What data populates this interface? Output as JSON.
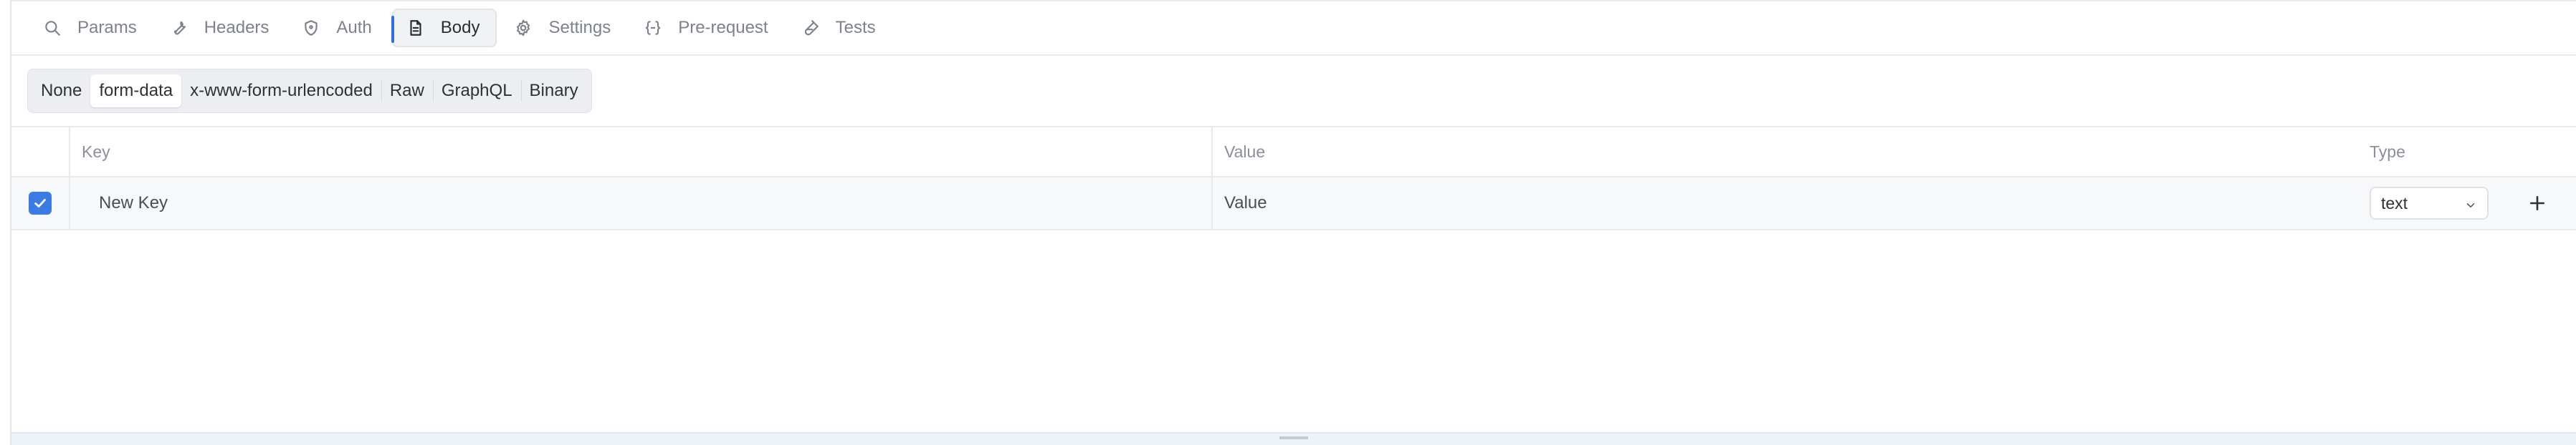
{
  "tabs": [
    {
      "label": "Params",
      "icon": "search-icon"
    },
    {
      "label": "Headers",
      "icon": "wrench-icon"
    },
    {
      "label": "Auth",
      "icon": "shield-icon"
    },
    {
      "label": "Body",
      "icon": "document-icon",
      "active": true
    },
    {
      "label": "Settings",
      "icon": "gear-icon"
    },
    {
      "label": "Pre-request",
      "icon": "braces-icon"
    },
    {
      "label": "Tests",
      "icon": "flask-icon"
    }
  ],
  "body_types": [
    {
      "label": "None"
    },
    {
      "label": "form-data",
      "active": true
    },
    {
      "label": "x-www-form-urlencoded"
    },
    {
      "label": "Raw"
    },
    {
      "label": "GraphQL"
    },
    {
      "label": "Binary"
    }
  ],
  "table": {
    "headers": {
      "key": "Key",
      "value": "Value",
      "type": "Type"
    },
    "rows": [
      {
        "checked": true,
        "key_placeholder": "New Key",
        "key_value": "",
        "value_placeholder": "Value",
        "value_value": "",
        "type": "text"
      }
    ]
  },
  "colors": {
    "accent": "#3b7be4",
    "border": "#e7e9ec",
    "muted_text": "#7d828b"
  }
}
